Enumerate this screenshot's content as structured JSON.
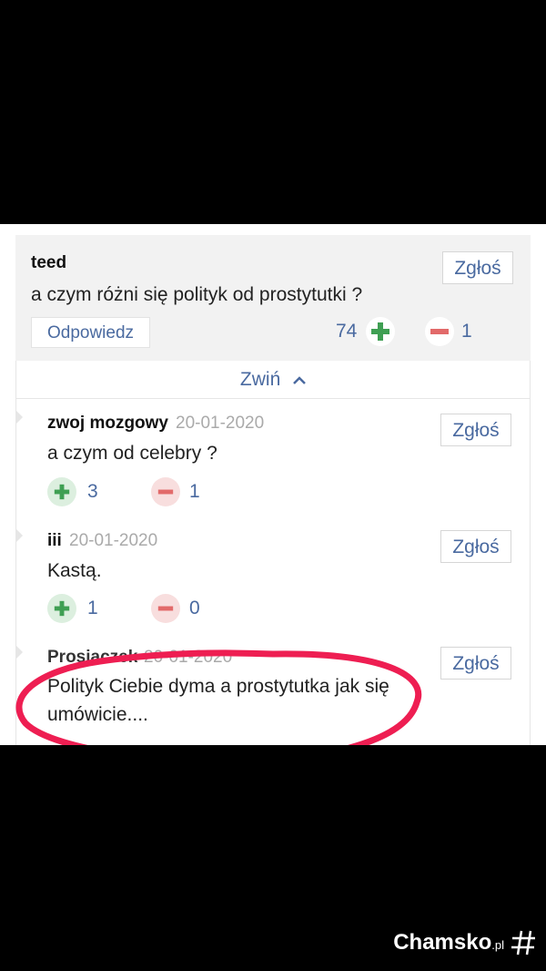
{
  "main_comment": {
    "author": "teed",
    "text": "a czym różni się polityk od prostytutki ?",
    "report_label": "Zgłoś",
    "reply_label": "Odpowiedz",
    "upvotes": "74",
    "downvotes": "1"
  },
  "collapse_label": "Zwiń",
  "replies": [
    {
      "author": "zwoj mozgowy",
      "date": "20-01-2020",
      "text": "a czym od celebry ?",
      "report_label": "Zgłoś",
      "upvotes": "3",
      "downvotes": "1"
    },
    {
      "author": "iii",
      "date": "20-01-2020",
      "text": "Kastą.",
      "report_label": "Zgłoś",
      "upvotes": "1",
      "downvotes": "0"
    },
    {
      "author": "Prosiaczek",
      "date": "20-01-2020",
      "text_line1": "Polityk Ciebie dyma a prostytutka jak się",
      "text_line2": "umówicie....",
      "report_label": "Zgłoś"
    }
  ],
  "watermark": {
    "brand": "Chamsko",
    "tld": ".pl"
  },
  "colors": {
    "accent": "#4a6aa0",
    "upvote": "#3f9f53",
    "downvote": "#e26a6a",
    "highlight_ellipse": "#ee1e52"
  }
}
